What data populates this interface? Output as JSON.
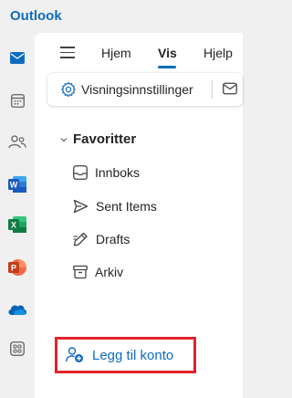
{
  "app": {
    "title": "Outlook"
  },
  "rail": {
    "items": [
      {
        "name": "mail-icon",
        "color": "#0f6cbd"
      },
      {
        "name": "calendar-icon",
        "color": "#616161"
      },
      {
        "name": "people-icon",
        "color": "#616161"
      },
      {
        "name": "word-icon",
        "color": "#185abd",
        "letter": "W"
      },
      {
        "name": "excel-icon",
        "color": "#107c41",
        "letter": "X"
      },
      {
        "name": "powerpoint-icon",
        "color": "#c43e1c",
        "letter": "P"
      },
      {
        "name": "onedrive-icon",
        "color": "#0364b8"
      },
      {
        "name": "more-apps-icon",
        "color": "#616161"
      }
    ]
  },
  "ribbon": {
    "tabs": [
      {
        "label": "Hjem"
      },
      {
        "label": "Vis",
        "active": true
      },
      {
        "label": "Hjelp"
      }
    ],
    "toolbar": {
      "view_settings_label": "Visningsinnstillinger"
    }
  },
  "folders": {
    "favorites_label": "Favoritter",
    "items": [
      {
        "label": "Innboks",
        "icon": "inbox-icon"
      },
      {
        "label": "Sent Items",
        "icon": "send-icon"
      },
      {
        "label": "Drafts",
        "icon": "pencil-icon"
      },
      {
        "label": "Arkiv",
        "icon": "archive-icon"
      }
    ]
  },
  "add_account": {
    "label": "Legg til konto"
  },
  "colors": {
    "accent": "#0f6cbd",
    "highlight_border": "#e0242a"
  }
}
